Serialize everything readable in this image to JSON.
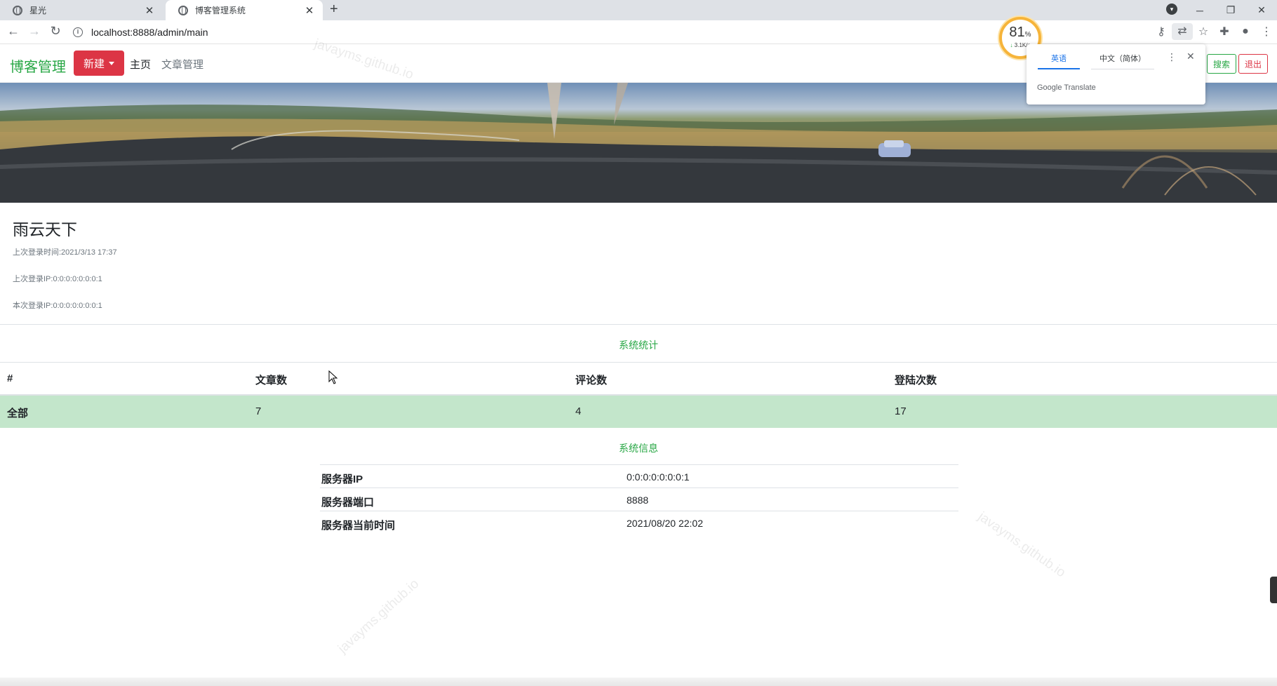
{
  "browser": {
    "tabs": [
      {
        "title": "星光",
        "active": false
      },
      {
        "title": "博客管理系统",
        "active": true
      }
    ],
    "new_tab_glyph": "+",
    "url": "localhost:8888/admin/main"
  },
  "speed_widget": {
    "percent": "81",
    "percent_unit": "%",
    "rate": "3.1K/s"
  },
  "translate_popup": {
    "source_lang": "英语",
    "target_lang": "中文（简体）",
    "brand": "Google Translate"
  },
  "navbar": {
    "brand": "博客管理",
    "new_button": "新建",
    "home_link": "主页",
    "articles_link": "文章管理",
    "search_button": "搜索",
    "logout_button": "退出"
  },
  "profile": {
    "name": "雨云天下",
    "last_login_time": "上次登录时间:2021/3/13 17:37",
    "last_login_ip": "上次登录IP:0:0:0:0:0:0:0:1",
    "current_login_ip": "本次登录IP:0:0:0:0:0:0:0:1"
  },
  "stats": {
    "title": "系统统计",
    "headers": [
      "#",
      "文章数",
      "评论数",
      "登陆次数"
    ],
    "row": [
      "全部",
      "7",
      "4",
      "17"
    ]
  },
  "sysinfo": {
    "title": "系统信息",
    "rows": [
      {
        "label": "服务器IP",
        "value": "0:0:0:0:0:0:0:1"
      },
      {
        "label": "服务器端口",
        "value": "8888"
      },
      {
        "label": "服务器当前时间",
        "value": "2021/08/20 22:02"
      }
    ]
  },
  "watermark": "javayms.github.io",
  "colors": {
    "brand_green": "#28a745",
    "danger_red": "#dc3545",
    "stats_row_bg": "#c3e6cb"
  }
}
